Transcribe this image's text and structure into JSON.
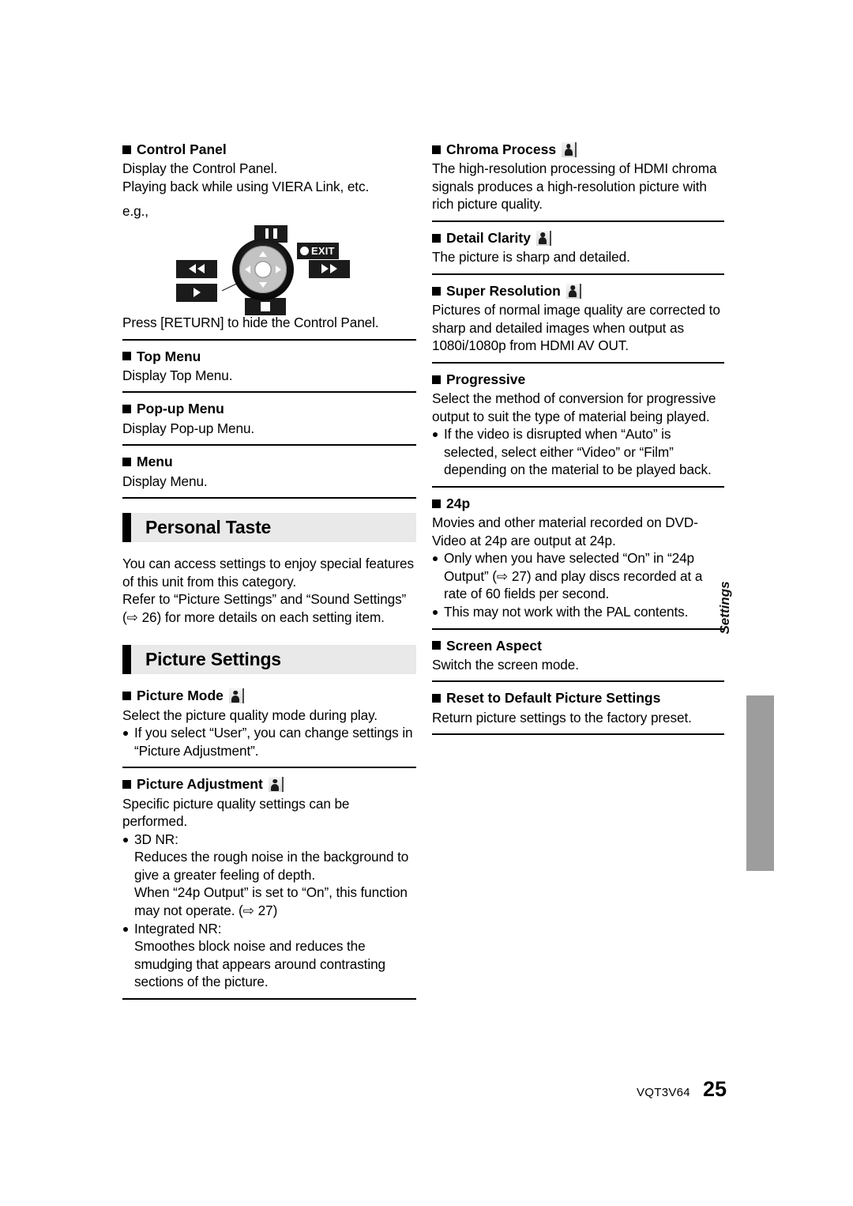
{
  "document": {
    "footer_code": "VQT3V64",
    "page_number": "25",
    "side_tab_label": "Settings"
  },
  "icons": {
    "person_icon": "person-bust-icon",
    "arrow_ref": "⇨"
  },
  "left_column": {
    "control_panel": {
      "heading": "Control Panel",
      "line1": "Display the Control Panel.",
      "line2": "Playing back while using VIERA Link, etc.",
      "eg_label": "e.g.,",
      "caption": "Press [RETURN] to hide the Control Panel."
    },
    "diagram": {
      "pause_button": "pause-icon",
      "exit_button": "EXIT",
      "rewind_button": "rewind-icon",
      "forward_button": "fast-forward-icon",
      "play_button": "play-icon",
      "stop_button": "stop-icon",
      "dial": "direction-dial"
    },
    "top_menu": {
      "heading": "Top Menu",
      "body": "Display Top Menu."
    },
    "popup_menu": {
      "heading": "Pop-up Menu",
      "body": "Display Pop-up Menu."
    },
    "menu": {
      "heading": "Menu",
      "body": "Display Menu."
    },
    "personal_taste": {
      "banner": "Personal Taste",
      "para1_a": "You can access settings to enjoy special features",
      "para1_b": "of this unit from this category.",
      "para2_a": "Refer to “Picture Settings” and “Sound Settings”",
      "para2_b": "(⇨ 26) for more details on each setting item."
    },
    "picture_settings": {
      "banner": "Picture Settings",
      "picture_mode": {
        "heading": "Picture Mode",
        "has_icon": true,
        "body": "Select the picture quality mode during play.",
        "bullets": [
          "If you select “User”, you can change settings in “Picture Adjustment”."
        ]
      },
      "picture_adjustment": {
        "heading": "Picture Adjustment",
        "has_icon": true,
        "body": "Specific picture quality settings can be performed.",
        "items": [
          {
            "label": "3D NR:",
            "lines": [
              "Reduces the rough noise in the background to",
              "give a greater feeling of depth.",
              "When “24p Output” is set to “On”, this function",
              "may not operate. (⇨ 27)"
            ]
          },
          {
            "label": "Integrated NR:",
            "lines": [
              "Smoothes block noise and reduces the",
              "smudging that appears around contrasting",
              "sections of the picture."
            ]
          }
        ]
      }
    }
  },
  "right_column": {
    "chroma_process": {
      "heading": "Chroma Process",
      "has_icon": true,
      "body": "The high-resolution processing of HDMI chroma signals produces a high-resolution picture with rich picture quality."
    },
    "detail_clarity": {
      "heading": "Detail Clarity",
      "has_icon": true,
      "body": "The picture is sharp and detailed."
    },
    "super_resolution": {
      "heading": "Super Resolution",
      "has_icon": true,
      "body": "Pictures of normal image quality are corrected to sharp and detailed images when output as 1080i/1080p from HDMI AV OUT."
    },
    "progressive": {
      "heading": "Progressive",
      "has_icon": false,
      "body": "Select the method of conversion for progressive output to suit the type of material being played.",
      "bullets": [
        "If the video is disrupted when “Auto” is selected, select either “Video” or “Film” depending on the material to be played back."
      ]
    },
    "p24": {
      "heading": "24p",
      "has_icon": false,
      "body": "Movies and other material recorded on DVD-Video at 24p are output at 24p.",
      "bullets": [
        "Only when you have selected “On” in “24p Output” (⇨ 27) and play discs recorded at a rate of 60 fields per second.",
        "This may not work with the PAL contents."
      ]
    },
    "screen_aspect": {
      "heading": "Screen Aspect",
      "has_icon": false,
      "body": "Switch the screen mode."
    },
    "reset_defaults": {
      "heading": "Reset to Default Picture Settings",
      "has_icon": false,
      "body": "Return picture settings to the factory preset."
    }
  }
}
